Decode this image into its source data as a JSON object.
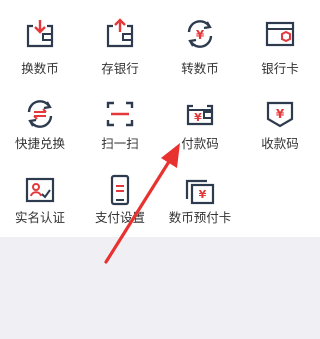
{
  "grid": {
    "items": [
      {
        "label": "换数币",
        "icon": "exchange-coin-icon"
      },
      {
        "label": "存银行",
        "icon": "deposit-bank-icon"
      },
      {
        "label": "转数币",
        "icon": "transfer-coin-icon"
      },
      {
        "label": "银行卡",
        "icon": "bank-card-icon"
      },
      {
        "label": "快捷兑换",
        "icon": "quick-exchange-icon"
      },
      {
        "label": "扫一扫",
        "icon": "scan-icon"
      },
      {
        "label": "付款码",
        "icon": "payment-code-icon"
      },
      {
        "label": "收款码",
        "icon": "receive-code-icon"
      },
      {
        "label": "实名认证",
        "icon": "real-name-auth-icon"
      },
      {
        "label": "支付设置",
        "icon": "payment-settings-icon"
      },
      {
        "label": "数币预付卡",
        "icon": "prepaid-card-icon"
      }
    ]
  },
  "colors": {
    "icon_dark": "#2e3a4e",
    "icon_accent": "#e4393c",
    "arrow": "#e8322f",
    "bottom_bg": "#f0f0f4"
  }
}
